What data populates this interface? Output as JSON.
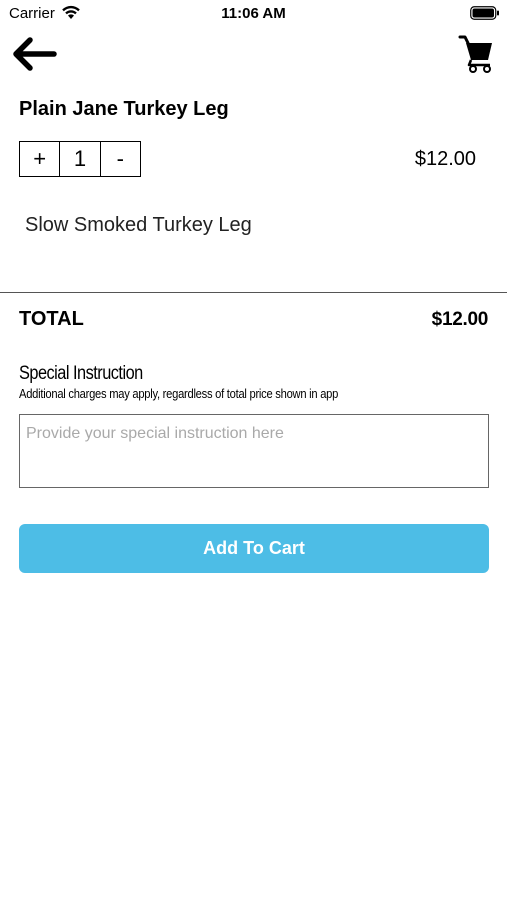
{
  "status_bar": {
    "carrier": "Carrier",
    "time": "11:06 AM"
  },
  "nav": {
    "back_icon": "arrow-left-icon",
    "cart_icon": "shopping-cart-icon"
  },
  "product": {
    "name": "Plain Jane Turkey Leg",
    "quantity": "1",
    "increment_label": "+",
    "decrement_label": "-",
    "price": "$12.00",
    "description": "Slow Smoked Turkey Leg"
  },
  "total": {
    "label": "TOTAL",
    "value": "$12.00"
  },
  "special_instruction": {
    "title": "Special Instruction",
    "note": "Additional charges may apply, regardless of total price shown in app",
    "placeholder": "Provide your special instruction here",
    "value": ""
  },
  "actions": {
    "add_to_cart_label": "Add To Cart"
  },
  "colors": {
    "accent": "#4dbde6",
    "text": "#000000",
    "placeholder": "#a9a9a9"
  }
}
